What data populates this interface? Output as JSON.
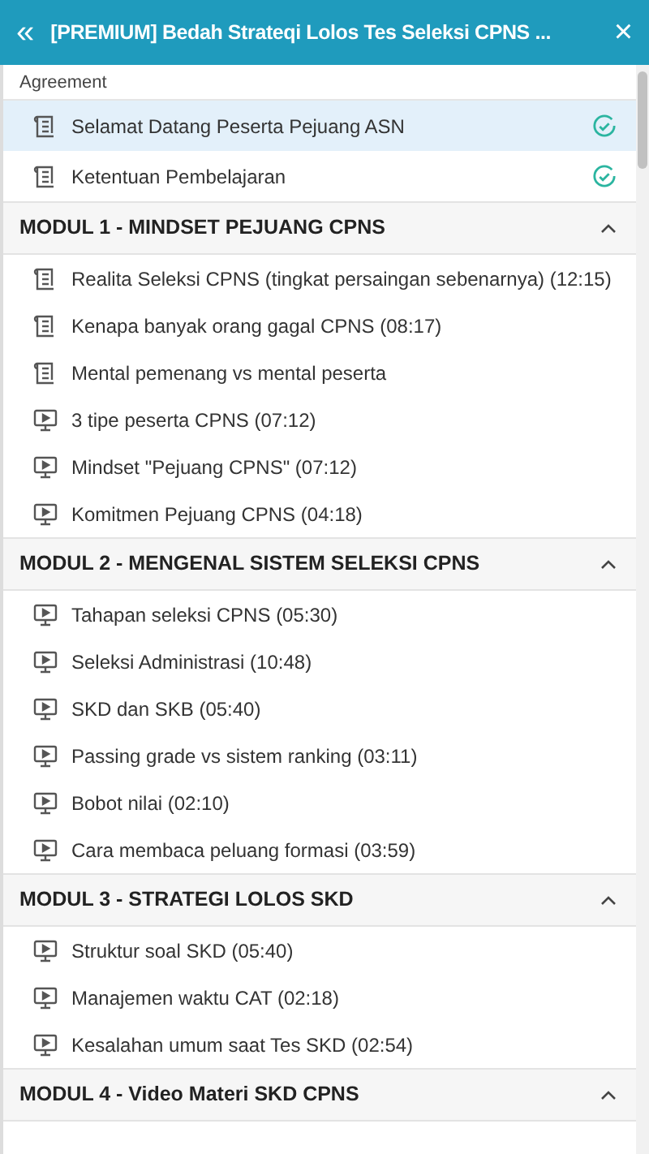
{
  "header": {
    "back": "«",
    "title": "[PREMIUM] Bedah Strateqi Lolos Tes Seleksi CPNS ...",
    "close": "×"
  },
  "sections": [
    {
      "title": "Agreement",
      "kind": "plain",
      "items": [
        {
          "kind": "document",
          "title": "Selamat Datang Peserta Pejuang ASN",
          "selected": true,
          "done": true
        },
        {
          "kind": "document",
          "title": "Ketentuan Pembelajaran",
          "selected": false,
          "done": true
        }
      ]
    },
    {
      "title": "MODUL 1 - MINDSET PEJUANG CPNS",
      "kind": "module",
      "expanded": true,
      "items": [
        {
          "kind": "document",
          "title": "Realita Seleksi CPNS (tingkat persaingan sebenarnya) (12:15)",
          "selected": false,
          "done": false
        },
        {
          "kind": "document",
          "title": "Kenapa banyak orang gagal CPNS (08:17)",
          "selected": false,
          "done": false
        },
        {
          "kind": "document",
          "title": "Mental pemenang vs mental peserta",
          "selected": false,
          "done": false
        },
        {
          "kind": "video",
          "title": "3 tipe peserta CPNS (07:12)",
          "selected": false,
          "done": false
        },
        {
          "kind": "video",
          "title": "Mindset \"Pejuang CPNS\" (07:12)",
          "selected": false,
          "done": false
        },
        {
          "kind": "video",
          "title": "Komitmen Pejuang CPNS (04:18)",
          "selected": false,
          "done": false
        }
      ]
    },
    {
      "title": "MODUL 2 - MENGENAL SISTEM SELEKSI CPNS",
      "kind": "module",
      "expanded": true,
      "items": [
        {
          "kind": "video",
          "title": "Tahapan seleksi CPNS (05:30)",
          "selected": false,
          "done": false
        },
        {
          "kind": "video",
          "title": "Seleksi Administrasi (10:48)",
          "selected": false,
          "done": false
        },
        {
          "kind": "video",
          "title": "SKD dan SKB (05:40)",
          "selected": false,
          "done": false
        },
        {
          "kind": "video",
          "title": "Passing grade vs sistem ranking (03:11)",
          "selected": false,
          "done": false
        },
        {
          "kind": "video",
          "title": "Bobot nilai (02:10)",
          "selected": false,
          "done": false
        },
        {
          "kind": "video",
          "title": "Cara membaca peluang formasi (03:59)",
          "selected": false,
          "done": false
        }
      ]
    },
    {
      "title": "MODUL 3 - STRATEGI LOLOS SKD",
      "kind": "module",
      "expanded": true,
      "items": [
        {
          "kind": "video",
          "title": "Struktur soal SKD (05:40)",
          "selected": false,
          "done": false
        },
        {
          "kind": "video",
          "title": "Manajemen waktu CAT (02:18)",
          "selected": false,
          "done": false
        },
        {
          "kind": "video",
          "title": "Kesalahan umum saat Tes SKD (02:54)",
          "selected": false,
          "done": false
        }
      ]
    },
    {
      "title": "MODUL 4 - Video Materi SKD CPNS",
      "kind": "module",
      "expanded": true
    }
  ]
}
